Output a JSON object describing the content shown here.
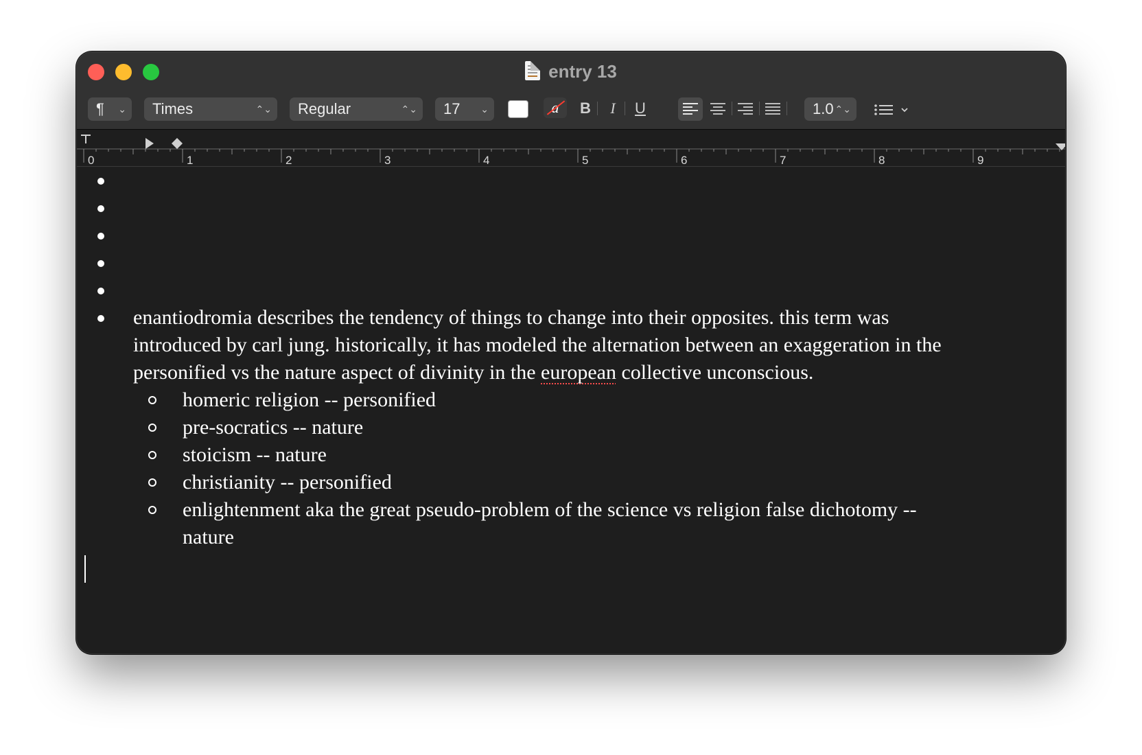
{
  "window": {
    "title": "entry 13"
  },
  "toolbar": {
    "paragraph_symbol": "¶",
    "font_family": "Times",
    "font_style": "Regular",
    "font_size": "17",
    "text_color": "#ffffff",
    "highlight_label": "a",
    "bold_label": "B",
    "italic_label": "I",
    "underline_label": "U",
    "alignment": "left",
    "line_spacing": "1.0"
  },
  "ruler": {
    "labels": [
      "0",
      "1",
      "2",
      "3",
      "4",
      "5",
      "6",
      "7",
      "8",
      "9"
    ]
  },
  "document": {
    "empty_bullet_count": 5,
    "paragraph_lines": [
      "enantiodromia describes the tendency of things to change into their opposites. this term was",
      "introduced by carl jung. historically, it has modeled the alternation between an exaggeration in the"
    ],
    "paragraph_line3_before": "personified vs the nature aspect of divinity in the ",
    "paragraph_line3_misspelled": "european",
    "paragraph_line3_after": " collective unconscious.",
    "sub_items": [
      "homeric religion -- personified",
      "pre-socratics -- nature",
      "stoicism -- nature",
      "christianity -- personified",
      "enlightenment aka the great pseudo-problem of the science vs religion false dichotomy --"
    ],
    "sub_item_continuation": "nature"
  }
}
